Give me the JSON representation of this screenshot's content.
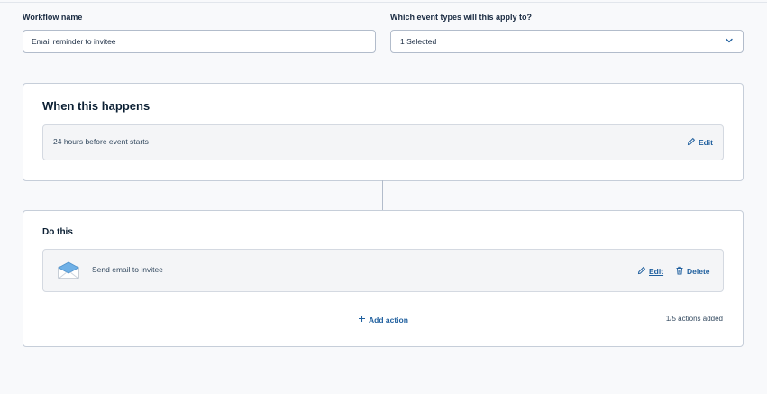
{
  "form": {
    "workflow_name_label": "Workflow name",
    "workflow_name_value": "Email reminder to invitee",
    "event_types_label": "Which event types will this apply to?",
    "event_types_selected": "1 Selected"
  },
  "trigger": {
    "title": "When this happens",
    "condition": "24 hours before event starts",
    "edit_label": "Edit"
  },
  "actions": {
    "title": "Do this",
    "items": [
      {
        "label": "Send email to invitee",
        "edit_label": "Edit",
        "delete_label": "Delete",
        "icon": "envelope-icon"
      }
    ],
    "add_label": "Add action",
    "count_text": "1/5 actions added"
  },
  "colors": {
    "link": "#1f5f9e",
    "border": "#c6ced9",
    "text": "#1a2b42",
    "envelope": "#6fb0e6"
  }
}
